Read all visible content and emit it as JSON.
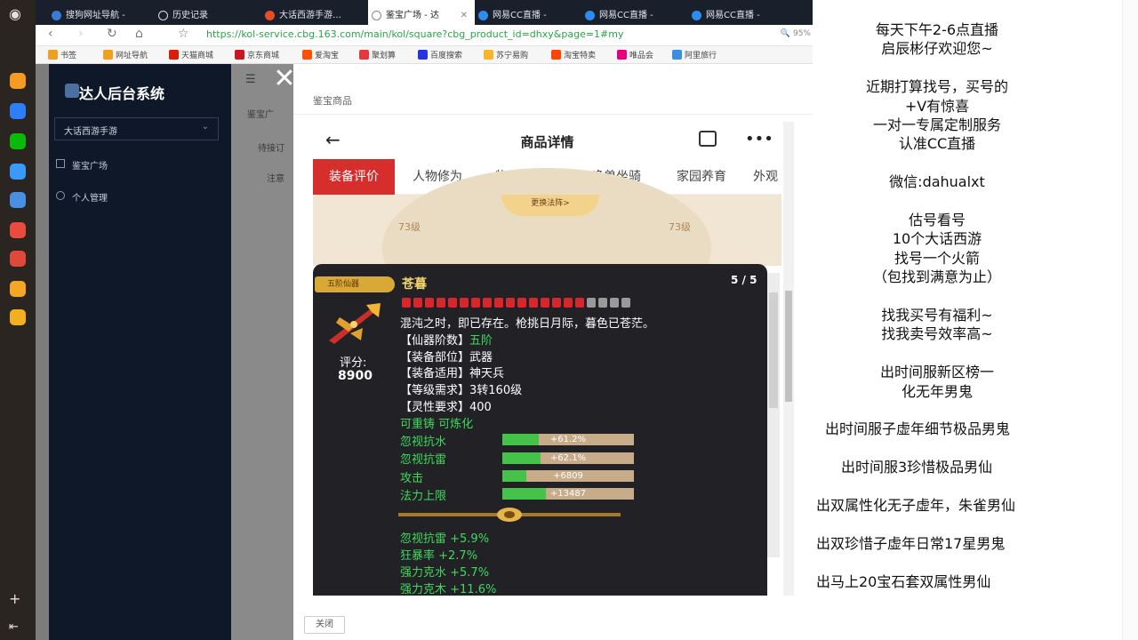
{
  "browser": {
    "tabs": [
      {
        "label": "搜狗网址导航 -",
        "icon_color": "#3a7bd5"
      },
      {
        "label": "历史记录",
        "icon_color": "#e0e0e0"
      },
      {
        "label": "大话西游手游…",
        "icon_color": "#e44d26"
      },
      {
        "label": "鉴宝广场 - 达",
        "icon_color": "#888888"
      },
      {
        "label": "网易CC直播 - ",
        "icon_color": "#2d8cf0"
      },
      {
        "label": "网易CC直播 - ",
        "icon_color": "#2d8cf0"
      },
      {
        "label": "网易CC直播 - ",
        "icon_color": "#2d8cf0"
      }
    ],
    "url": "https://kol-service.cbg.163.com/main/kol/square?cbg_product_id=dhxy&page=1#my",
    "zoom": "95%",
    "bookmarks": [
      {
        "label": "书签",
        "color": "#f0a020"
      },
      {
        "label": "网址导航",
        "color": "#f0a020"
      },
      {
        "label": "天猫商城",
        "color": "#d81e06"
      },
      {
        "label": "京东商城",
        "color": "#c81623"
      },
      {
        "label": "爱淘宝",
        "color": "#ff5000"
      },
      {
        "label": "聚划算",
        "color": "#e4393c"
      },
      {
        "label": "百度搜索",
        "color": "#2932e1"
      },
      {
        "label": "苏宁易购",
        "color": "#f7b52c"
      },
      {
        "label": "淘宝特卖",
        "color": "#ff4400"
      },
      {
        "label": "唯品会",
        "color": "#e4007f"
      },
      {
        "label": "阿里旅行",
        "color": "#3a8ee6"
      }
    ]
  },
  "sidebar": {
    "title": "达人后台系统",
    "game_select": "大话西游手游",
    "items": [
      {
        "label": "鉴宝广场"
      },
      {
        "label": "个人管理"
      }
    ]
  },
  "main": {
    "crumb": "鉴宝广",
    "tab": "待接订",
    "note_title": "注意"
  },
  "modal": {
    "header": "鉴宝商品",
    "close_label": "关闭",
    "close_glyph": "✕"
  },
  "phone": {
    "title": "商品详情",
    "back_glyph": "←",
    "more_glyph": "•••",
    "tabs": [
      "装备评价",
      "人物修为",
      "物品道具",
      "召唤兽坐骑",
      "家园养育",
      "外观"
    ],
    "bg": {
      "level_left": "73级",
      "level_right": "73级",
      "button": "更换法阵>"
    },
    "item": {
      "badge": "五阶仙器",
      "name": "苍暮",
      "page": "5 / 5",
      "score_label": "评分:",
      "score": "8900",
      "gems_red": 16,
      "gems_gray": 4,
      "description": "混沌之时，即已存在。枪挑日月际，暮色已苍茫。",
      "attributes": [
        {
          "key": "【仙器阶数】",
          "value": "五阶",
          "green": true
        },
        {
          "key": "【装备部位】",
          "value": "武器",
          "green": false
        },
        {
          "key": "【装备适用】",
          "value": "神天兵",
          "green": false
        },
        {
          "key": "【等级需求】",
          "value": "3转160级",
          "green": false
        },
        {
          "key": "【灵性要求】",
          "value": "400",
          "green": false
        }
      ],
      "reforge": "可重铸 可炼化",
      "bonuses": [
        {
          "label": "忽视抗水",
          "value": "+61.2%",
          "fill": 0.28
        },
        {
          "label": "忽视抗雷",
          "value": "+62.1%",
          "fill": 0.29
        },
        {
          "label": "攻击",
          "value": "+6809",
          "fill": 0.18
        },
        {
          "label": "法力上限",
          "value": "+13487",
          "fill": 0.33
        }
      ],
      "extras": [
        "忽视抗雷 +5.9%",
        "狂暴率 +2.7%",
        "强力克水 +5.7%",
        "强力克木 +11.6%"
      ]
    }
  },
  "right_panel": {
    "lines": [
      "每天下午2-6点直播",
      "启辰彬仔欢迎您~",
      "",
      "近期打算找号，买号的",
      "+V有惊喜",
      "一对一专属定制服务",
      "认准CC直播",
      "",
      "微信:dahualxt",
      "",
      "估号看号",
      "10个大话西游",
      "找号一个火箭",
      "（包找到满意为止）",
      "",
      "找我买号有福利~",
      "找我卖号效率高~",
      "",
      "出时间服新区榜一",
      "化无年男鬼",
      "",
      "出时间服子虚年细节极品男鬼",
      "",
      "出时间服3珍惜极品男仙",
      "",
      "出双属性化无子虚年，朱雀男仙",
      "",
      "出双珍惜子虚年日常17星男鬼",
      "",
      "出马上20宝石套双属性男仙"
    ]
  }
}
